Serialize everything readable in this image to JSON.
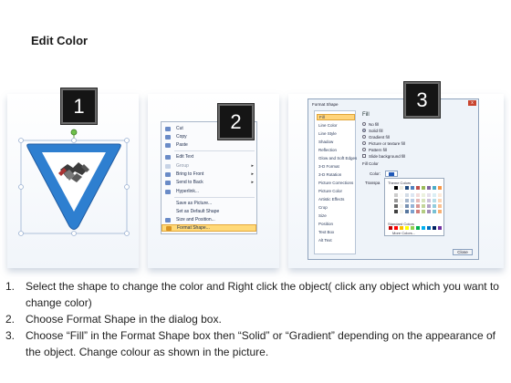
{
  "page": {
    "title": "Edit Color"
  },
  "steps": [
    {
      "number": "1"
    },
    {
      "number": "2"
    },
    {
      "number": "3"
    }
  ],
  "context_menu": {
    "items": [
      {
        "label": "Cut",
        "arrow": ""
      },
      {
        "label": "Copy",
        "arrow": ""
      },
      {
        "label": "Paste",
        "arrow": ""
      },
      {
        "label": "Edit Text",
        "arrow": ""
      },
      {
        "label": "Group",
        "arrow": "▸"
      },
      {
        "label": "Bring to Front",
        "arrow": "▸"
      },
      {
        "label": "Send to Back",
        "arrow": "▸"
      },
      {
        "label": "Hyperlink...",
        "arrow": ""
      },
      {
        "label": "Save as Picture...",
        "arrow": ""
      },
      {
        "label": "Set as Default Shape",
        "arrow": ""
      },
      {
        "label": "Size and Position...",
        "arrow": ""
      },
      {
        "label": "Format Shape...",
        "arrow": ""
      }
    ]
  },
  "format_dialog": {
    "title": "Format Shape",
    "close": "x",
    "categories": [
      "Fill",
      "Line Color",
      "Line Style",
      "Shadow",
      "Reflection",
      "Glow and Soft Edges",
      "3-D Format",
      "3-D Rotation",
      "Picture Corrections",
      "Picture Color",
      "Artistic Effects",
      "Crop",
      "Size",
      "Position",
      "Text Box",
      "Alt Text"
    ],
    "fill_heading": "Fill",
    "options": [
      "No fill",
      "Solid fill",
      "Gradient fill",
      "Picture or texture fill",
      "Pattern fill",
      "Slide background fill"
    ],
    "fill_color_label": "Fill Color",
    "color_label": "Color:",
    "transparency_label": "Transpa",
    "theme_colors_label": "Theme Colors",
    "standard_colors_label": "Standard Colors",
    "more_colors_label": "More Colors...",
    "close_button": "Close",
    "accent_color": "#1f58b8"
  },
  "instructions": [
    {
      "num": "1.",
      "text": "Select the shape to change the color and Right click the object( click any object which you want to change color)"
    },
    {
      "num": "2.",
      "text": "Choose Format Shape in the dialog box."
    },
    {
      "num": "3.",
      "text": "Choose “Fill” in the Format Shape box then “Solid” or “Gradient” depending on the appearance of the object. Change colour as shown in the picture."
    }
  ]
}
